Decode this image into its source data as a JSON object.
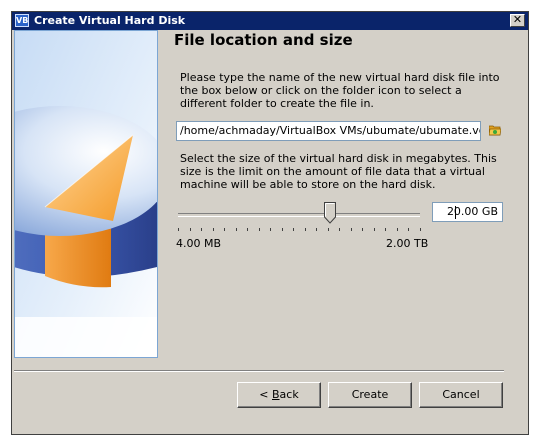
{
  "window": {
    "title": "Create Virtual Hard Disk",
    "close_label": "✕",
    "app_icon_label": "VB"
  },
  "page": {
    "title": "File location and size",
    "location_description": "Please type the name of the new virtual hard disk file into the box below or click on the folder icon to select a different folder to create the file in.",
    "size_description": "Select the size of the virtual hard disk in megabytes. This size is the limit on the amount of file data that a virtual machine will be able to store on the hard disk."
  },
  "location": {
    "value": "/home/achmaday/VirtualBox VMs/ubumate/ubumate.vdi"
  },
  "size": {
    "value": "20.00 GB",
    "min_label": "4.00 MB",
    "max_label": "2.00 TB",
    "slider_position": 0.63,
    "tick_count": 22
  },
  "buttons": {
    "back_prefix": "< ",
    "back_mnemonic": "B",
    "back_rest": "ack",
    "create": "Create",
    "cancel": "Cancel"
  },
  "icons": {
    "app": "virtualbox-icon",
    "folder": "folder-icon",
    "close": "close-icon"
  }
}
